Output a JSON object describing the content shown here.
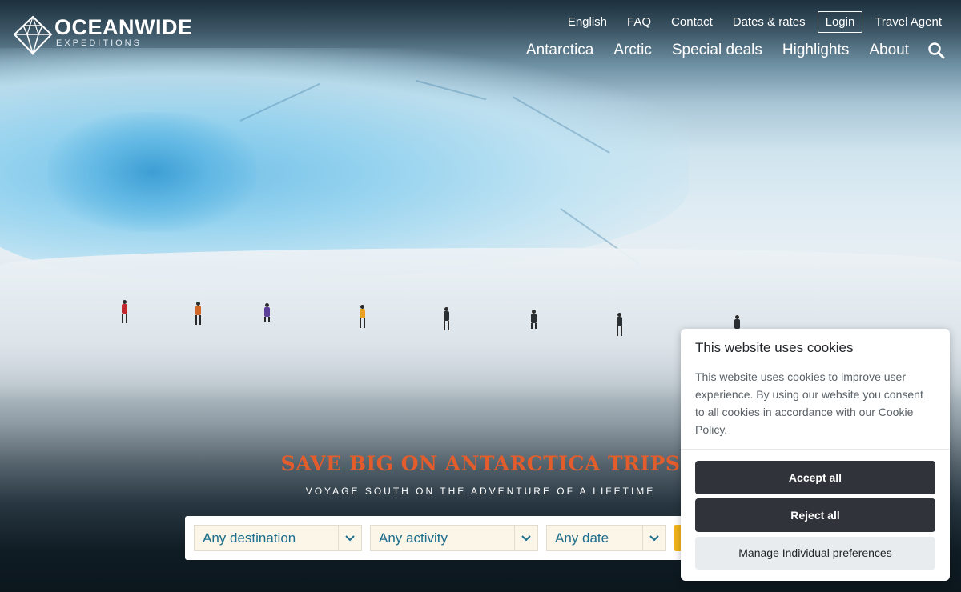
{
  "brand": {
    "name": "OCEANWIDE",
    "tagline": "EXPEDITIONS"
  },
  "top_nav": [
    "English",
    "FAQ",
    "Contact",
    "Dates & rates",
    "Login",
    "Travel Agent"
  ],
  "main_nav": [
    "Antarctica",
    "Arctic",
    "Special deals",
    "Highlights",
    "About"
  ],
  "icons": {
    "logo": "diamond-logo-icon",
    "search": "search-icon",
    "dropdown": "chevron-down-icon"
  },
  "promo": {
    "title": "SAVE BIG ON ANTARCTICA TRIPS",
    "subtitle": "VOYAGE SOUTH ON THE ADVENTURE OF A LIFETIME"
  },
  "search": {
    "destination": "Any destination",
    "activity": "Any activity",
    "date": "Any date"
  },
  "cookie": {
    "title": "This website uses cookies",
    "text": "This website uses cookies to improve user experience. By using our website you consent to all cookies in accordance with our Cookie Policy.",
    "accept": "Accept all",
    "reject": "Reject all",
    "manage": "Manage Individual preferences"
  },
  "colors": {
    "accent": "#e35d2c",
    "link": "#1d6d8c",
    "button_yellow": "#f2b41c",
    "dark_button": "#30343a"
  }
}
